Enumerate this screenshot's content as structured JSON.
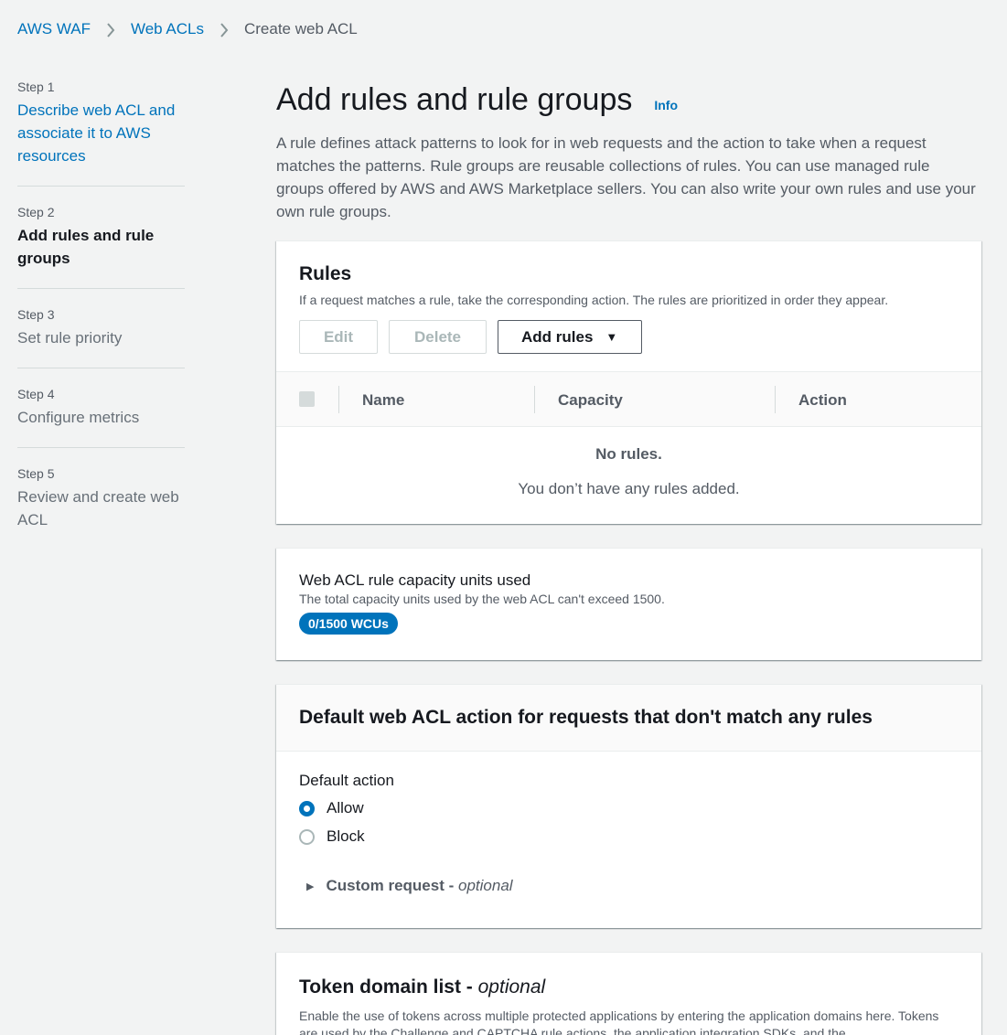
{
  "breadcrumb": {
    "items": [
      "AWS WAF",
      "Web ACLs"
    ],
    "current": "Create web ACL"
  },
  "steps": [
    {
      "num": "Step 1",
      "title": "Describe web ACL and associate it to AWS resources"
    },
    {
      "num": "Step 2",
      "title": "Add rules and rule groups"
    },
    {
      "num": "Step 3",
      "title": "Set rule priority"
    },
    {
      "num": "Step 4",
      "title": "Configure metrics"
    },
    {
      "num": "Step 5",
      "title": "Review and create web ACL"
    }
  ],
  "header": {
    "title": "Add rules and rule groups",
    "info": "Info",
    "description": "A rule defines attack patterns to look for in web requests and the action to take when a request matches the patterns. Rule groups are reusable collections of rules. You can use managed rule groups offered by AWS and AWS Marketplace sellers. You can also write your own rules and use your own rule groups."
  },
  "rules": {
    "title": "Rules",
    "description": "If a request matches a rule, take the corresponding action. The rules are prioritized in order they appear.",
    "edit_label": "Edit",
    "delete_label": "Delete",
    "add_label": "Add rules",
    "columns": [
      "Name",
      "Capacity",
      "Action"
    ],
    "empty_title": "No rules.",
    "empty_desc": "You don’t have any rules added."
  },
  "capacity": {
    "label": "Web ACL rule capacity units used",
    "desc": "The total capacity units used by the web ACL can't exceed 1500.",
    "badge": "0/1500 WCUs"
  },
  "default_action": {
    "title": "Default web ACL action for requests that don't match any rules",
    "label": "Default action",
    "options": [
      "Allow",
      "Block"
    ],
    "selected": "Allow",
    "custom_request": "Custom request - ",
    "custom_request_optional": "optional"
  },
  "token": {
    "title": "Token domain list - ",
    "title_optional": "optional",
    "desc": "Enable the use of tokens across multiple protected applications by entering the application domains here. Tokens are used by the Challenge and CAPTCHA rule actions, the application integration SDKs, and the"
  },
  "colors": {
    "link": "#0073bb",
    "background": "#f2f3f3",
    "badge": "#0073bb"
  }
}
